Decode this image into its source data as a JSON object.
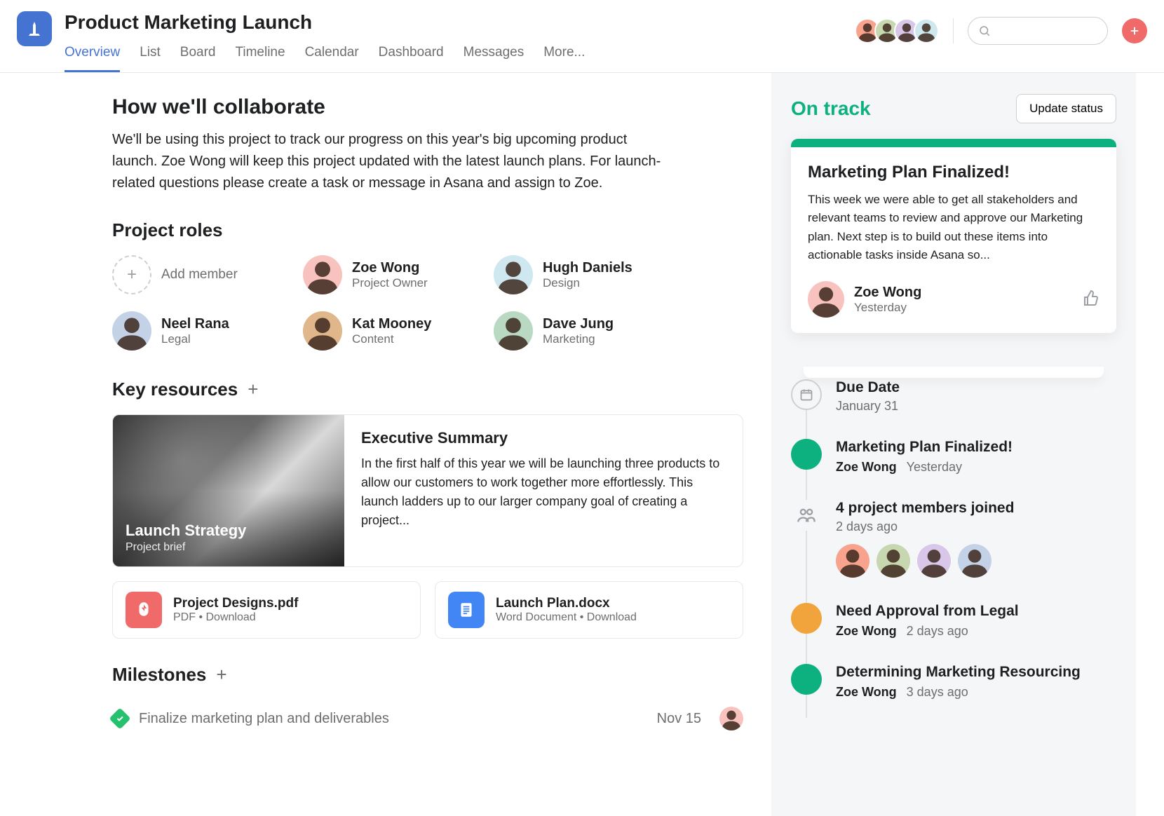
{
  "project": {
    "title": "Product Marketing Launch"
  },
  "tabs": [
    {
      "label": "Overview",
      "active": true
    },
    {
      "label": "List"
    },
    {
      "label": "Board"
    },
    {
      "label": "Timeline"
    },
    {
      "label": "Calendar"
    },
    {
      "label": "Dashboard"
    },
    {
      "label": "Messages"
    },
    {
      "label": "More..."
    }
  ],
  "collab": {
    "heading": "How we'll collaborate",
    "body": "We'll be using this project to track our progress on this year's big upcoming product launch. Zoe Wong will keep this project updated with the latest launch plans. For launch-related questions please create a task or message in Asana and assign to Zoe."
  },
  "roles": {
    "heading": "Project roles",
    "add_label": "Add member",
    "items": [
      {
        "name": "Zoe Wong",
        "role": "Project Owner"
      },
      {
        "name": "Hugh Daniels",
        "role": "Design"
      },
      {
        "name": "Neel Rana",
        "role": "Legal"
      },
      {
        "name": "Kat Mooney",
        "role": "Content"
      },
      {
        "name": "Dave Jung",
        "role": "Marketing"
      }
    ]
  },
  "resources": {
    "heading": "Key resources",
    "card": {
      "image_title": "Launch Strategy",
      "image_sub": "Project brief",
      "title": "Executive Summary",
      "body": "In the first half of this year we will be launching three products to allow our customers to work together more effortlessly. This launch ladders up to our larger company goal of creating a project..."
    },
    "files": [
      {
        "name": "Project Designs.pdf",
        "meta": "PDF  •  Download",
        "type": "pdf"
      },
      {
        "name": "Launch Plan.docx",
        "meta": "Word Document  •  Download",
        "type": "doc"
      }
    ]
  },
  "milestones": {
    "heading": "Milestones",
    "items": [
      {
        "text": "Finalize marketing plan and deliverables",
        "date": "Nov 15",
        "done": true
      }
    ]
  },
  "status": {
    "label": "On track",
    "update_label": "Update status",
    "card": {
      "title": "Marketing Plan Finalized!",
      "body": "This week we were able to get all stakeholders and relevant teams to review and approve our Marketing plan. Next step is to build out these items into actionable tasks inside Asana so...",
      "author": "Zoe Wong",
      "time": "Yesterday"
    }
  },
  "timeline": [
    {
      "kind": "due",
      "title": "Due Date",
      "sub": "January 31"
    },
    {
      "kind": "green",
      "title": "Marketing Plan Finalized!",
      "author": "Zoe Wong",
      "time": "Yesterday"
    },
    {
      "kind": "people",
      "title": "4 project members joined",
      "time": "2 days ago"
    },
    {
      "kind": "orange",
      "title": "Need Approval from Legal",
      "author": "Zoe Wong",
      "time": "2 days ago"
    },
    {
      "kind": "green",
      "title": "Determining Marketing Resourcing",
      "author": "Zoe Wong",
      "time": "3 days ago"
    }
  ]
}
